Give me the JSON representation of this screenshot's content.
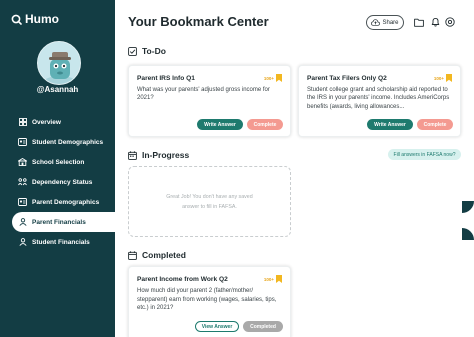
{
  "app": {
    "logo_text": "Humo"
  },
  "user": {
    "username": "@Asannah"
  },
  "sidebar": {
    "items": [
      {
        "label": "Overview",
        "icon": "grid-icon"
      },
      {
        "label": "Student Demographics",
        "icon": "id-card-icon"
      },
      {
        "label": "School Selection",
        "icon": "school-icon"
      },
      {
        "label": "Dependency Status",
        "icon": "people-link-icon"
      },
      {
        "label": "Parent Demographics",
        "icon": "id-card-icon"
      },
      {
        "label": "Parent Financials",
        "icon": "person-icon",
        "active": true
      },
      {
        "label": "Student Financials",
        "icon": "person-icon"
      }
    ]
  },
  "header": {
    "title": "Your Bookmark Center",
    "share_label": "Share"
  },
  "todo": {
    "heading": "To-Do",
    "cards": [
      {
        "title": "Parent IRS Info Q1",
        "badge": "100+",
        "body": "What was your parents' adjusted gross income for 2021?",
        "primary": "Write Answer",
        "secondary": "Complete"
      },
      {
        "title": "Parent Tax Filers Only Q2",
        "badge": "100+",
        "body": "Student college grant and scholarship aid reported to the IRS in your parents' income. Includes AmeriCorps benefits (awards, living allowances...",
        "primary": "Write Answer",
        "secondary": "Complete"
      }
    ]
  },
  "in_progress": {
    "heading": "In-Progress",
    "link": "Fill answers in FAFSA now?",
    "empty_text": "Great Job! You don't have any saved answer to fill in FAFSA."
  },
  "completed": {
    "heading": "Completed",
    "cards": [
      {
        "title": "Parent Income from Work Q2",
        "badge": "100+",
        "body": "How much did your parent 2 (father/mother/ stepparent) earn from working (wages, salaries, tips, etc.) in 2021?",
        "primary": "View Answer",
        "secondary": "Completed"
      }
    ]
  },
  "colors": {
    "sidebar_bg": "#133d44",
    "accent_teal": "#1e7a6e",
    "complete_pink": "#f49a91",
    "bookmark_gold": "#f2b720"
  }
}
